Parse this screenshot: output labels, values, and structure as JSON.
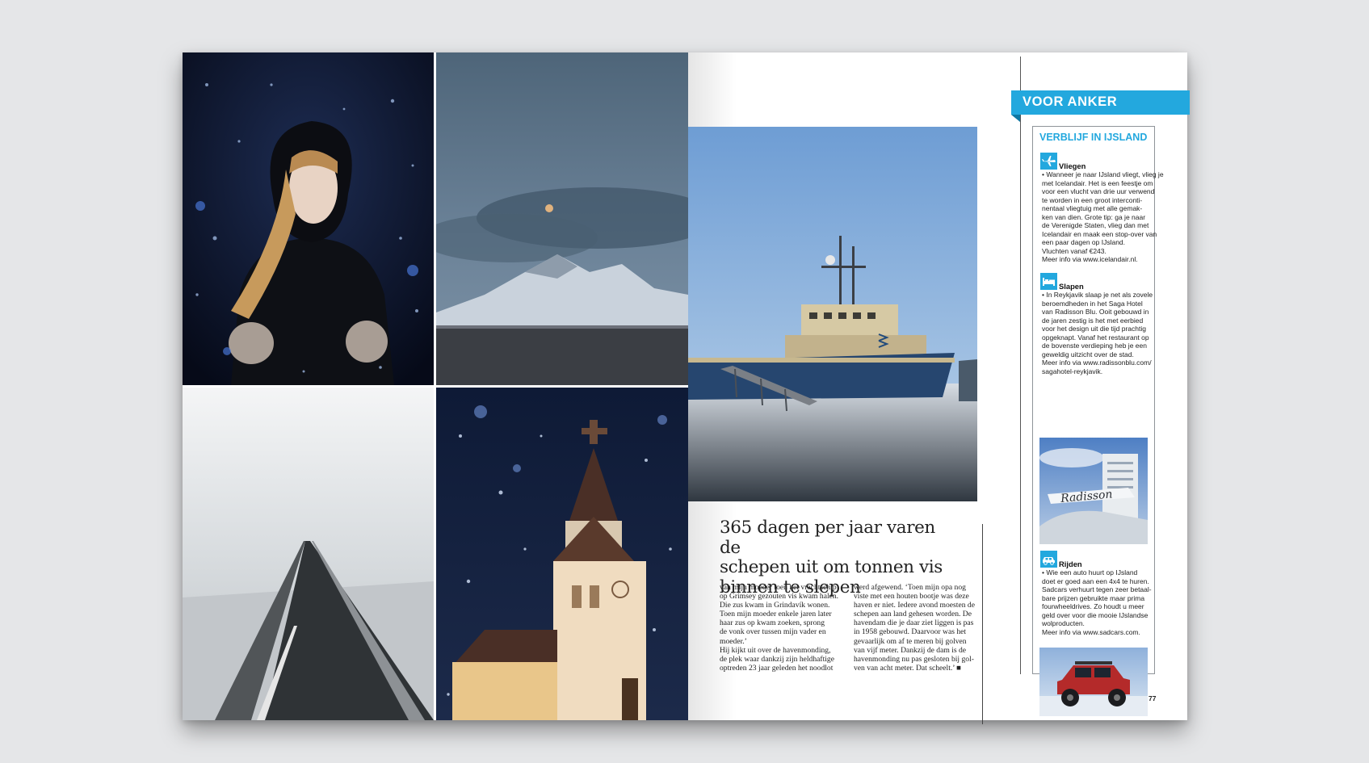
{
  "article": {
    "headline_lines": [
      "365 dagen per jaar varen de",
      "schepen uit om tonnen vis",
      "binnen te slepen"
    ],
    "col1_lines": [
      "van mijn moeder toen het vrachtschip",
      "op Grimsey gezouten vis kwam halen.",
      "Die zus kwam in Grindavík wonen.",
      "Toen mijn moeder enkele jaren later",
      "haar zus op kwam zoeken, sprong",
      "de vonk over tussen mijn vader en",
      "moeder.’",
      "Hij kijkt uit over de havenmonding,",
      "de plek waar dankzij zijn heldhaftige",
      "optreden 23 jaar geleden het noodlot"
    ],
    "col2_lines": [
      "werd afgewend. ‘Toen mijn opa nog",
      "viste met een houten bootje was deze",
      "haven er niet. Iedere avond moesten de",
      "schepen aan land gehesen worden. De",
      "havendam die je daar ziet liggen is pas",
      "in 1958 gebouwd. Daarvoor was het",
      "gevaarlijk om af te meren bij golven",
      "van vijf meter. Dankzij de dam is de",
      "havenmonding nu pas gesloten bij gol-",
      "ven van acht meter. Dat scheelt.’ ■"
    ]
  },
  "sidebar": {
    "tab_label": "VOOR ANKER",
    "box_title": "VERBLIJF IN IJSLAND",
    "sections": [
      {
        "icon": "airplane-icon",
        "heading": "Vliegen",
        "lines": [
          "• Wanneer je naar IJsland vliegt, vlieg je",
          "met Icelandair. Het is een feestje om",
          "voor een vlucht van drie uur verwend",
          "te worden in een groot interconti-",
          "nentaal vliegtuig met alle gemak-",
          "ken van dien. Grote tip: ga je naar",
          "de Verenigde Staten, vlieg dan met",
          "Icelandair en maak een stop-over van",
          "een paar dagen op IJsland.",
          "Vluchten vanaf €243.",
          "Meer info via www.icelandair.nl."
        ]
      },
      {
        "icon": "bed-icon",
        "heading": "Slapen",
        "lines": [
          "• In Reykjavik slaap je net als zovele",
          "beroemdheden in het Saga Hotel",
          "van Radisson Blu. Ooit gebouwd in",
          "de jaren zestig is het met eerbied",
          "voor het design uit die tijd prachtig",
          "opgeknapt. Vanaf het restaurant op",
          "de bovenste verdieping heb je een",
          "geweldig uitzicht over de stad.",
          "Meer info via www.radissonblu.com/",
          "sagahotel-reykjavik."
        ]
      },
      {
        "icon": "car-icon",
        "heading": "Rijden",
        "lines": [
          "• Wie een auto huurt op IJsland",
          "doet er goed aan een 4x4 te huren.",
          "Sadcars verhuurt tegen zeer betaal-",
          "bare prijzen gebruikte maar prima",
          "fourwheeldrives. Zo houdt u meer",
          "geld over voor die mooie IJslandse",
          "wolproducten.",
          "Meer info via www.sadcars.com."
        ]
      }
    ],
    "hotel_sign_text": "Radisson"
  },
  "page_number": "77",
  "colors": {
    "accent": "#23a8de",
    "accent_dark": "#0f78a4",
    "text": "#222222"
  }
}
